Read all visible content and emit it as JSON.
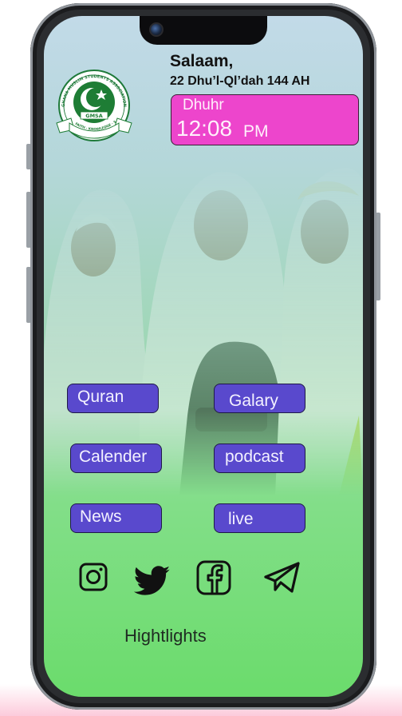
{
  "header": {
    "greeting": "Salaam,",
    "hijri_date": "22 Dhu’l-Ql’dah 144 AH"
  },
  "prayer": {
    "name": "Dhuhr",
    "time": "12:08",
    "ampm": "PM",
    "card_color": "#ed45cc"
  },
  "logo": {
    "top_text": "GHANA MUSLIM STUDENTS ASSOCIATION UNIVERSITY OF MINES AND TECHNOLOGY",
    "center_text": "GMSA",
    "motto": "FAITH · KNOWLEDGE · SERVICE",
    "icon": "crescent-star-emblem"
  },
  "nav": {
    "button_color": "#5949cd",
    "quran": "Quran",
    "galary": "Galary",
    "calender": "Calender",
    "podcast": "podcast",
    "news": "News",
    "live": "live"
  },
  "social": [
    {
      "name": "instagram",
      "icon": "instagram-icon"
    },
    {
      "name": "twitter",
      "icon": "twitter-icon"
    },
    {
      "name": "facebook",
      "icon": "facebook-icon"
    },
    {
      "name": "telegram",
      "icon": "telegram-icon"
    }
  ],
  "footer": {
    "highlights": "Hightlights"
  }
}
